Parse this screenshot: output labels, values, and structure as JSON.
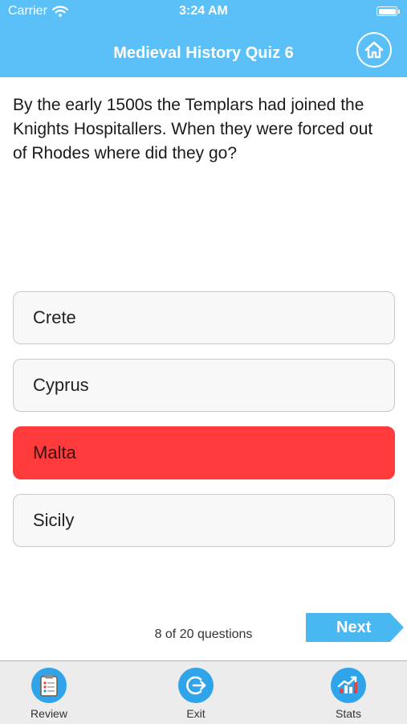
{
  "status_bar": {
    "carrier": "Carrier",
    "time": "3:24 AM"
  },
  "header": {
    "title": "Medieval History Quiz 6",
    "home_icon": "home-icon",
    "background_color": "#5bbff8"
  },
  "question": {
    "text": "By the early 1500s the Templars had joined the Knights Hospitallers. When they were forced out of Rhodes where did they go?"
  },
  "answers": [
    {
      "label": "Crete",
      "state": "normal"
    },
    {
      "label": "Cyprus",
      "state": "normal"
    },
    {
      "label": "Malta",
      "state": "wrong"
    },
    {
      "label": "Sicily",
      "state": "normal"
    }
  ],
  "colors": {
    "wrong_answer": "#ff3b3b",
    "accent": "#2fa4ea"
  },
  "footer": {
    "progress_text": "8 of 20 questions",
    "next_label": "Next"
  },
  "tab_bar": {
    "items": [
      {
        "label": "Review",
        "icon": "review-clipboard-icon"
      },
      {
        "label": "Exit",
        "icon": "exit-icon"
      },
      {
        "label": "Stats",
        "icon": "stats-chart-icon"
      }
    ]
  }
}
